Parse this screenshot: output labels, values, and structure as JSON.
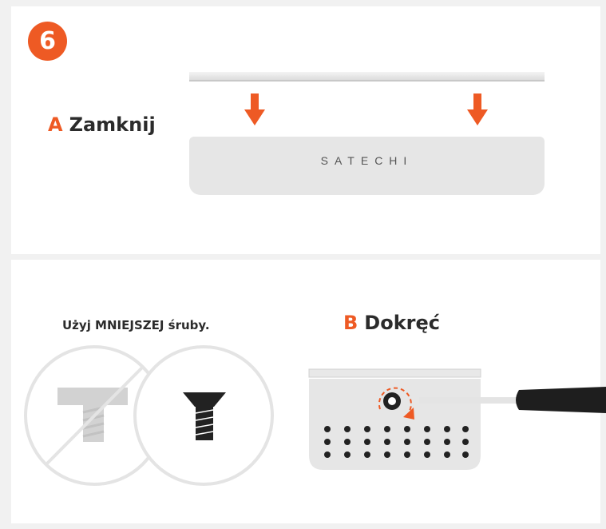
{
  "step": {
    "number": "6"
  },
  "section_a": {
    "letter": "A",
    "label": "Zamknij"
  },
  "enclosure": {
    "brand": "SATECHI"
  },
  "screws": {
    "caption": "Użyj MNIEJSZEJ śruby."
  },
  "section_b": {
    "letter": "B",
    "label": "Dokręć"
  },
  "colors": {
    "accent": "#ee5a24",
    "panel": "#ffffff",
    "background": "#f1f1f1",
    "device": "#e6e6e6"
  },
  "icons": [
    "down-arrow-icon",
    "prohibited-screw-icon",
    "correct-screw-icon",
    "screwdriver-icon",
    "rotate-clockwise-icon"
  ]
}
